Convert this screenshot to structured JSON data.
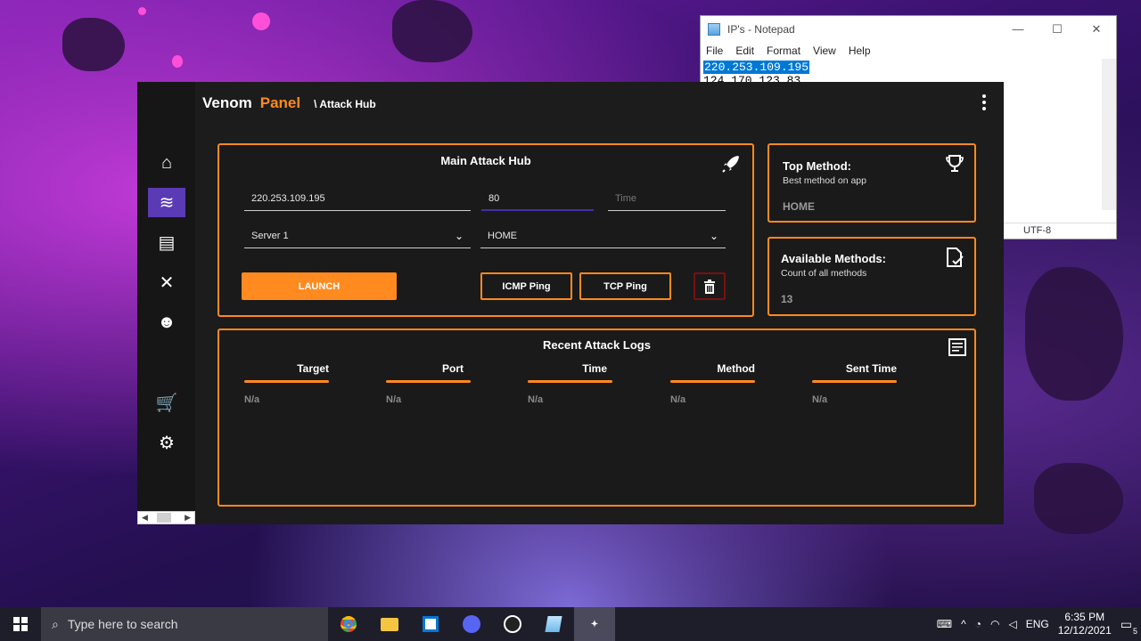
{
  "notepad": {
    "title": "IP's - Notepad",
    "window_buttons": [
      "—",
      "☐",
      "✕"
    ],
    "menu": [
      "File",
      "Edit",
      "Format",
      "View",
      "Help"
    ],
    "lines": [
      "220.253.109.195",
      "124.170.123.83"
    ],
    "status_encoding": "UTF-8"
  },
  "app": {
    "brand_first": "Venom",
    "brand_second": "Panel",
    "breadcrumb": "\\ Attack Hub",
    "accent": "#ff8a1f",
    "nav_active_color": "#5b3ab5",
    "nav": [
      {
        "icon": "home-icon",
        "glyph": "⌂"
      },
      {
        "icon": "wifi-off-icon",
        "glyph": "≋"
      },
      {
        "icon": "toolbox-icon",
        "glyph": "▤"
      },
      {
        "icon": "tools-icon",
        "glyph": "✕"
      },
      {
        "icon": "discord-icon",
        "glyph": "☻"
      },
      {
        "icon": "cart-icon",
        "glyph": "🛒"
      },
      {
        "icon": "settings-icon",
        "glyph": "⚙"
      }
    ],
    "attack_hub": {
      "title": "Main Attack Hub",
      "target_value": "220.253.109.195",
      "port_value": "80",
      "time_placeholder": "Time",
      "server_value": "Server 1",
      "method_value": "HOME",
      "launch_label": "LAUNCH",
      "icmp_label": "ICMP Ping",
      "tcp_label": "TCP Ping"
    },
    "top_method": {
      "title": "Top Method:",
      "subtitle": "Best method on app",
      "value": "HOME"
    },
    "available_methods": {
      "title": "Available Methods:",
      "subtitle": "Count of all methods",
      "value": "13"
    },
    "logs": {
      "title": "Recent Attack Logs",
      "columns": [
        {
          "header": "Target",
          "value": "N/a"
        },
        {
          "header": "Port",
          "value": "N/a"
        },
        {
          "header": "Time",
          "value": "N/a"
        },
        {
          "header": "Method",
          "value": "N/a"
        },
        {
          "header": "Sent Time",
          "value": "N/a"
        }
      ]
    }
  },
  "taskbar": {
    "search_placeholder": "Type here to search",
    "language": "ENG",
    "time": "6:35 PM",
    "date": "12/12/2021",
    "notification_count": "5"
  }
}
